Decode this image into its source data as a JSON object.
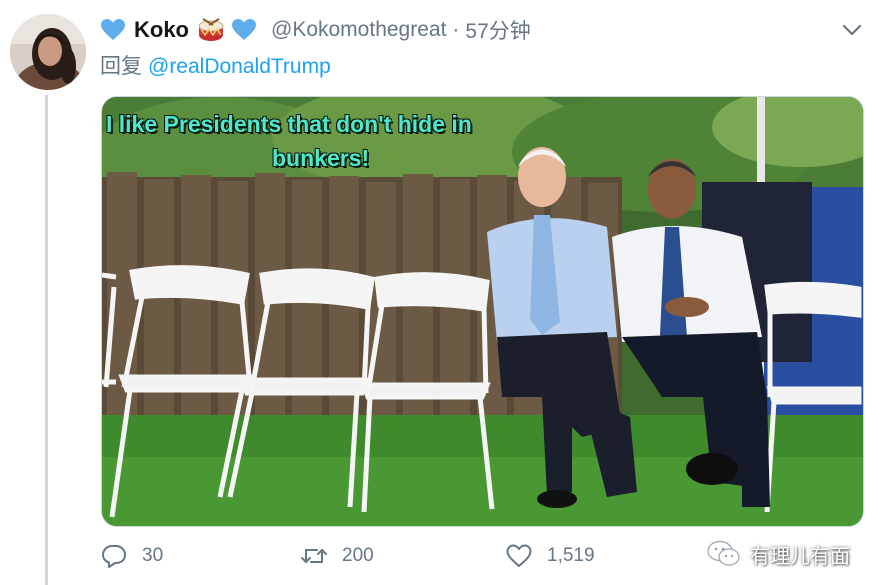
{
  "tweet": {
    "display_name": "Koko",
    "handle": "@Kokomothegreat",
    "separator": "·",
    "time": "57分钟",
    "reply_label": "回复",
    "reply_to": "@realDonaldTrump",
    "image_text_line1": "I like Presidents that don't hide in",
    "image_text_line2": "bunkers!",
    "reply_count": "30",
    "retweet_count": "200",
    "like_count": "1,519"
  },
  "watermark": {
    "text": "有理儿有面"
  },
  "colors": {
    "heart_blue": "#5dadec",
    "link_blue": "#1da1f2",
    "muted_gray": "#657786",
    "meme_text": "#4fe8cc"
  },
  "icons": [
    "blue-heart-icon",
    "drum-icon",
    "chevron-down-icon",
    "reply-icon",
    "retweet-icon",
    "like-icon",
    "wechat-logo-icon"
  ]
}
